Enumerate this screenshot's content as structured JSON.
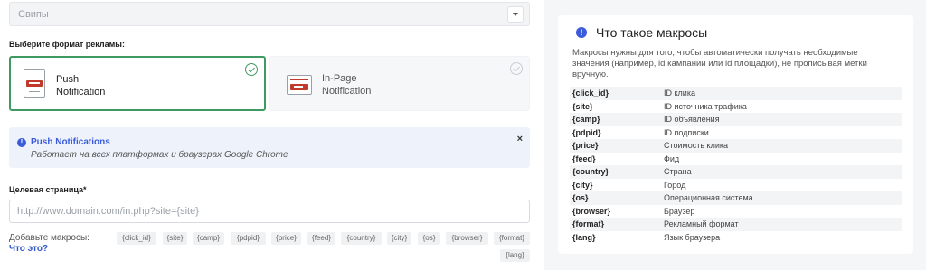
{
  "select": {
    "value": "Свипы"
  },
  "format": {
    "label": "Выберите формат рекламы:",
    "options": [
      {
        "line1": "Push",
        "line2": "Notification",
        "selected": true
      },
      {
        "line1": "In-Page",
        "line2": "Notification",
        "selected": false
      }
    ]
  },
  "info": {
    "title": "Push Notifications",
    "subtitle": "Работает на всех платформах и браузерах Google Chrome",
    "close": "×"
  },
  "target": {
    "label": "Целевая страница*",
    "placeholder": "http://www.domain.com/in.php?site={site}"
  },
  "macros_add": {
    "label": "Добавьте макросы:",
    "link": "Что это?",
    "chips": [
      "{click_id}",
      "{site}",
      "{camp}",
      "{pdpid}",
      "{price}",
      "{feed}",
      "{country}",
      "{city}",
      "{os}",
      "{browser}",
      "{format}",
      "{lang}"
    ]
  },
  "panel": {
    "icon": "!",
    "title": "Что такое макросы",
    "description": "Макросы нужны для того, чтобы автоматически получать необходимые значения (например, id кампании или id площадки), не прописывая метки вручную.",
    "rows": [
      {
        "key": "{click_id}",
        "value": "ID клика"
      },
      {
        "key": "{site}",
        "value": "ID источника трафика"
      },
      {
        "key": "{camp}",
        "value": "ID объявления"
      },
      {
        "key": "{pdpid}",
        "value": "ID подписки"
      },
      {
        "key": "{price}",
        "value": "Стоимость клика"
      },
      {
        "key": "{feed}",
        "value": "Фид"
      },
      {
        "key": "{country}",
        "value": "Страна"
      },
      {
        "key": "{city}",
        "value": "Город"
      },
      {
        "key": "{os}",
        "value": "Операционная система"
      },
      {
        "key": "{browser}",
        "value": "Браузер"
      },
      {
        "key": "{format}",
        "value": "Рекламный формат"
      },
      {
        "key": "{lang}",
        "value": "Язык браузера"
      }
    ]
  },
  "colors": {
    "accent": "#3b5bdb",
    "selected_border": "#3f9a62",
    "brand_red": "#c0392b"
  }
}
